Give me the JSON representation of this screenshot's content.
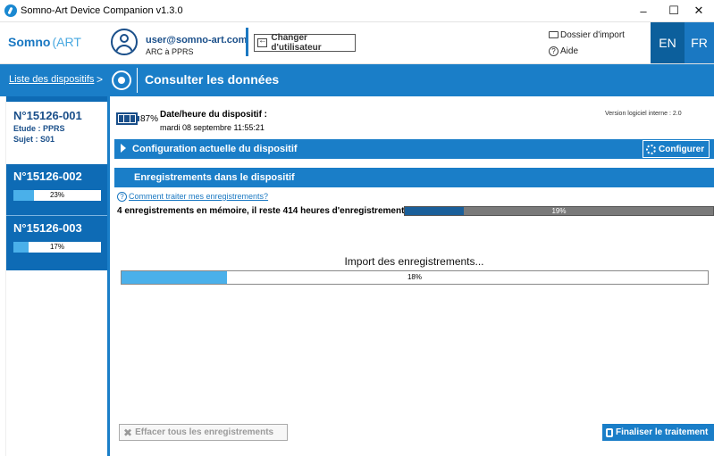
{
  "window": {
    "title": "Somno-Art Device Companion v1.3.0",
    "minimize": "–",
    "maximize": "☐",
    "close": "✕"
  },
  "header": {
    "logo_somno": "Somno",
    "logo_art": "ART",
    "user_email": "user@somno-art.com",
    "user_role": "ARC à PPRS",
    "switch_user": "Changer d'utilisateur",
    "import_folder": "Dossier d'import",
    "help": "Aide",
    "lang_en": "EN",
    "lang_fr": "FR"
  },
  "nav": {
    "breadcrumb": "Liste des dispositifs",
    "separator": ">",
    "title": "Consulter les données"
  },
  "sidebar": {
    "active": {
      "id": "N°15126-001",
      "study": "Etude : PPRS",
      "subject": "Sujet : S01"
    },
    "devices": [
      {
        "id": "N°15126-002",
        "progress": 23,
        "progress_label": "23%"
      },
      {
        "id": "N°15126-003",
        "progress": 17,
        "progress_label": "17%"
      }
    ]
  },
  "device": {
    "battery_pct": "87%",
    "datetime_label": "Date/heure du dispositif :",
    "datetime_value": "mardi 08 septembre  11:55:21",
    "version": "Version logiciel interne :  2.0"
  },
  "config": {
    "section_title": "Configuration actuelle du dispositif",
    "button": "Configurer"
  },
  "recordings": {
    "section_title": "Enregistrements dans le dispositif",
    "howto_link": "Comment traiter mes enregistrements?",
    "memory_text": "4 enregistrements en mémoire, il reste 414 heures d'enregistrement",
    "memory_progress": 19,
    "memory_label": "19%"
  },
  "import": {
    "label": "Import des enregistrements...",
    "progress": 18,
    "progress_label": "18%"
  },
  "footer": {
    "erase_button": "Effacer tous les enregistrements",
    "finalize_button": "Finaliser le traitement"
  },
  "colors": {
    "accent": "#1a7ec8",
    "dark_accent": "#0e6bb5",
    "progress_fill": "#4ab0ea"
  }
}
